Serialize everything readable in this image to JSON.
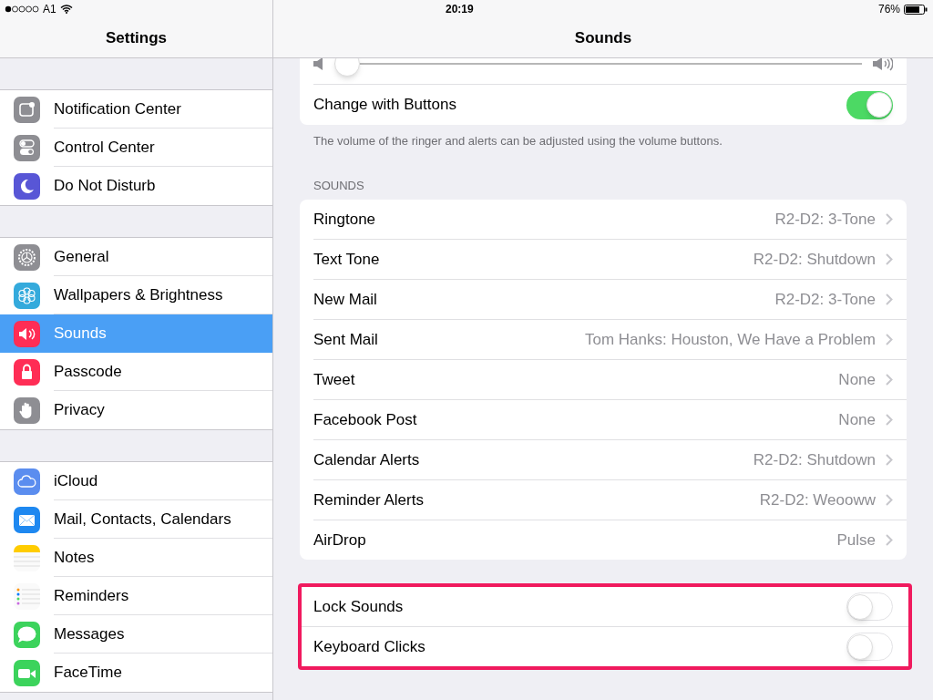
{
  "status_bar": {
    "carrier": "A1",
    "time": "20:19",
    "battery": "76%"
  },
  "sidebar": {
    "title": "Settings",
    "groups": [
      [
        {
          "label": "Notification Center",
          "kind": "notifications",
          "selected": false
        },
        {
          "label": "Control Center",
          "kind": "switches",
          "selected": false
        },
        {
          "label": "Do Not Disturb",
          "kind": "moon",
          "selected": false
        }
      ],
      [
        {
          "label": "General",
          "kind": "gear",
          "selected": false
        },
        {
          "label": "Wallpapers & Brightness",
          "kind": "flower",
          "selected": false
        },
        {
          "label": "Sounds",
          "kind": "speaker",
          "selected": true
        },
        {
          "label": "Passcode",
          "kind": "lock",
          "selected": false
        },
        {
          "label": "Privacy",
          "kind": "hand",
          "selected": false
        }
      ],
      [
        {
          "label": "iCloud",
          "kind": "cloud",
          "selected": false
        },
        {
          "label": "Mail, Contacts, Calendars",
          "kind": "mail",
          "selected": false
        },
        {
          "label": "Notes",
          "kind": "notes",
          "selected": false
        },
        {
          "label": "Reminders",
          "kind": "reminders",
          "selected": false
        },
        {
          "label": "Messages",
          "kind": "messages",
          "selected": false
        },
        {
          "label": "FaceTime",
          "kind": "video",
          "selected": false
        }
      ]
    ]
  },
  "detail": {
    "title": "Sounds",
    "volume": {
      "level": 0.0
    },
    "change_with_buttons": {
      "label": "Change with Buttons",
      "on": true
    },
    "footnote": "The volume of the ringer and alerts can be adjusted using the volume buttons.",
    "sounds_header": "SOUNDS",
    "sounds": [
      {
        "label": "Ringtone",
        "value": "R2-D2: 3-Tone"
      },
      {
        "label": "Text Tone",
        "value": "R2-D2: Shutdown"
      },
      {
        "label": "New Mail",
        "value": "R2-D2: 3-Tone"
      },
      {
        "label": "Sent Mail",
        "value": "Tom Hanks: Houston, We Have a Problem"
      },
      {
        "label": "Tweet",
        "value": "None"
      },
      {
        "label": "Facebook Post",
        "value": "None"
      },
      {
        "label": "Calendar Alerts",
        "value": "R2-D2: Shutdown"
      },
      {
        "label": "Reminder Alerts",
        "value": "R2-D2: Weooww"
      },
      {
        "label": "AirDrop",
        "value": "Pulse"
      }
    ],
    "lock_group": {
      "highlighted": true,
      "rows": [
        {
          "label": "Lock Sounds",
          "on": false
        },
        {
          "label": "Keyboard Clicks",
          "on": false
        }
      ]
    }
  }
}
